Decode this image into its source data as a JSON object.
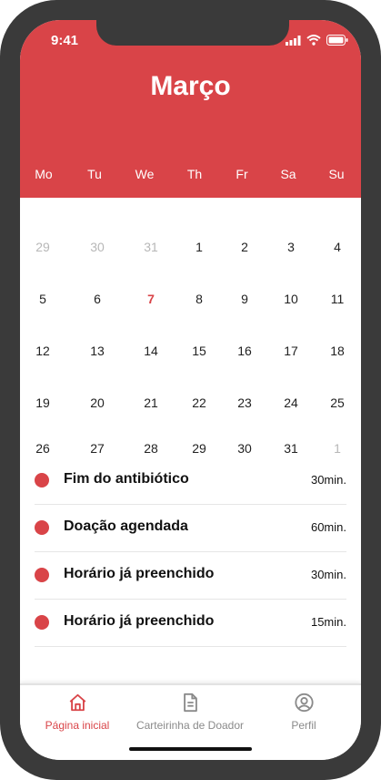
{
  "status_bar": {
    "time": "9:41"
  },
  "header": {
    "month": "Março"
  },
  "weekdays": [
    "Mo",
    "Tu",
    "We",
    "Th",
    "Fr",
    "Sa",
    "Su"
  ],
  "calendar": {
    "weeks": [
      [
        {
          "d": "29",
          "s": "muted"
        },
        {
          "d": "30",
          "s": "muted"
        },
        {
          "d": "31",
          "s": "muted"
        },
        {
          "d": "1",
          "s": ""
        },
        {
          "d": "2",
          "s": ""
        },
        {
          "d": "3",
          "s": ""
        },
        {
          "d": "4",
          "s": ""
        }
      ],
      [
        {
          "d": "5",
          "s": ""
        },
        {
          "d": "6",
          "s": ""
        },
        {
          "d": "7",
          "s": "today"
        },
        {
          "d": "8",
          "s": ""
        },
        {
          "d": "9",
          "s": ""
        },
        {
          "d": "10",
          "s": ""
        },
        {
          "d": "11",
          "s": ""
        }
      ],
      [
        {
          "d": "12",
          "s": ""
        },
        {
          "d": "13",
          "s": ""
        },
        {
          "d": "14",
          "s": ""
        },
        {
          "d": "15",
          "s": ""
        },
        {
          "d": "16",
          "s": ""
        },
        {
          "d": "17",
          "s": ""
        },
        {
          "d": "18",
          "s": ""
        }
      ],
      [
        {
          "d": "19",
          "s": ""
        },
        {
          "d": "20",
          "s": ""
        },
        {
          "d": "21",
          "s": ""
        },
        {
          "d": "22",
          "s": ""
        },
        {
          "d": "23",
          "s": ""
        },
        {
          "d": "24",
          "s": ""
        },
        {
          "d": "25",
          "s": ""
        }
      ],
      [
        {
          "d": "26",
          "s": ""
        },
        {
          "d": "27",
          "s": ""
        },
        {
          "d": "28",
          "s": ""
        },
        {
          "d": "29",
          "s": ""
        },
        {
          "d": "30",
          "s": ""
        },
        {
          "d": "31",
          "s": ""
        },
        {
          "d": "1",
          "s": "muted"
        }
      ]
    ]
  },
  "events": [
    {
      "title": "Fim do antibiótico",
      "duration": "30min."
    },
    {
      "title": "Doação agendada",
      "duration": "60min."
    },
    {
      "title": "Horário já preenchido",
      "duration": "30min."
    },
    {
      "title": "Horário já preenchido",
      "duration": "15min."
    }
  ],
  "tabbar": {
    "home": {
      "label": "Página inicial",
      "icon": "home-icon"
    },
    "card": {
      "label": "Carteirinha de Doador",
      "icon": "document-icon"
    },
    "profile": {
      "label": "Perfil",
      "icon": "user-circle-icon"
    }
  },
  "colors": {
    "accent": "#d94448",
    "frame": "#3a3a3a"
  }
}
